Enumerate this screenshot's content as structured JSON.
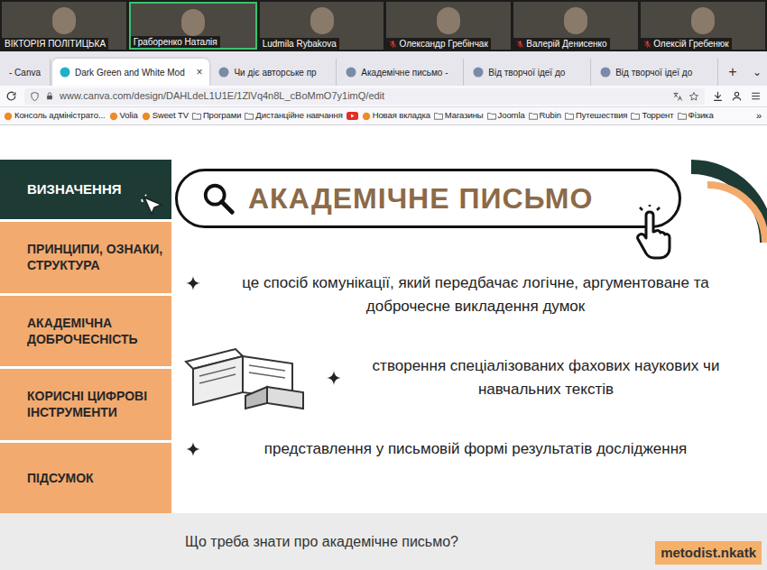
{
  "call": {
    "participants": [
      {
        "name": "ВІКТОРІЯ ПОЛІТИЦЬКА",
        "muted": false,
        "speaking": false
      },
      {
        "name": "Граборенко Наталія",
        "muted": false,
        "speaking": true
      },
      {
        "name": "Ludmila Rybakova",
        "muted": false,
        "speaking": false
      },
      {
        "name": "Олександр Гребінчак",
        "muted": true,
        "speaking": false
      },
      {
        "name": "Валерій Денисенко",
        "muted": true,
        "speaking": false
      },
      {
        "name": "Олексій Гребенюк",
        "muted": true,
        "speaking": false
      }
    ]
  },
  "browser": {
    "tabs": [
      {
        "label": "- Canva",
        "selected": false
      },
      {
        "label": "Dark Green and White Mod",
        "selected": true
      },
      {
        "label": "Чи діє авторське пр",
        "selected": false
      },
      {
        "label": "Академічне письмо -",
        "selected": false
      },
      {
        "label": "Від творчої ідеї до",
        "selected": false
      },
      {
        "label": "Від творчої ідеї до",
        "selected": false
      }
    ],
    "close": "×",
    "new_tab": "+",
    "tab_list": "⌄",
    "address": "www.canva.com/design/DAHLdeL1U1E/1ZlVq4n8L_cBoMmO7y1imQ/edit",
    "bookmarks": [
      {
        "label": "Консоль адміністрато...",
        "kind": "site"
      },
      {
        "label": "Volia",
        "kind": "site"
      },
      {
        "label": "Sweet TV",
        "kind": "site"
      },
      {
        "label": "Програми",
        "kind": "folder"
      },
      {
        "label": "Дистанційне навчання",
        "kind": "folder"
      },
      {
        "kind": "video"
      },
      {
        "label": "Новая вкладка",
        "kind": "site"
      },
      {
        "label": "Магазины",
        "kind": "folder"
      },
      {
        "label": "Joomla",
        "kind": "folder"
      },
      {
        "label": "Rubin",
        "kind": "folder"
      },
      {
        "label": "Путешествия",
        "kind": "folder"
      },
      {
        "label": "Торрент",
        "kind": "folder"
      },
      {
        "label": "Фізика",
        "kind": "folder"
      }
    ],
    "bookmarks_more": "»"
  },
  "slide": {
    "nav": [
      {
        "label": "ВИЗНАЧЕННЯ",
        "selected": true
      },
      {
        "label": "ПРИНЦИПИ, ОЗНАКИ, СТРУКТУРА",
        "selected": false
      },
      {
        "label": "АКАДЕМІЧНА ДОБРОЧЕСНІСТЬ",
        "selected": false
      },
      {
        "label": "КОРИСНІ ЦИФРОВІ ІНСТРУМЕНТИ",
        "selected": false
      },
      {
        "label": "ПІДСУМОК",
        "selected": false
      }
    ],
    "title": "АКАДЕМІЧНЕ ПИСЬМО",
    "points": [
      "це спосіб комунікації, який передбачає логічне, аргументоване та доброчесне викладення думок",
      "створення спеціалізованих фахових наукових чи навчальних текстів",
      "представлення у письмовій формі результатів дослідження"
    ]
  },
  "caption": "Що треба знати про академічне письмо?",
  "watermark": "metodist.nkatk"
}
